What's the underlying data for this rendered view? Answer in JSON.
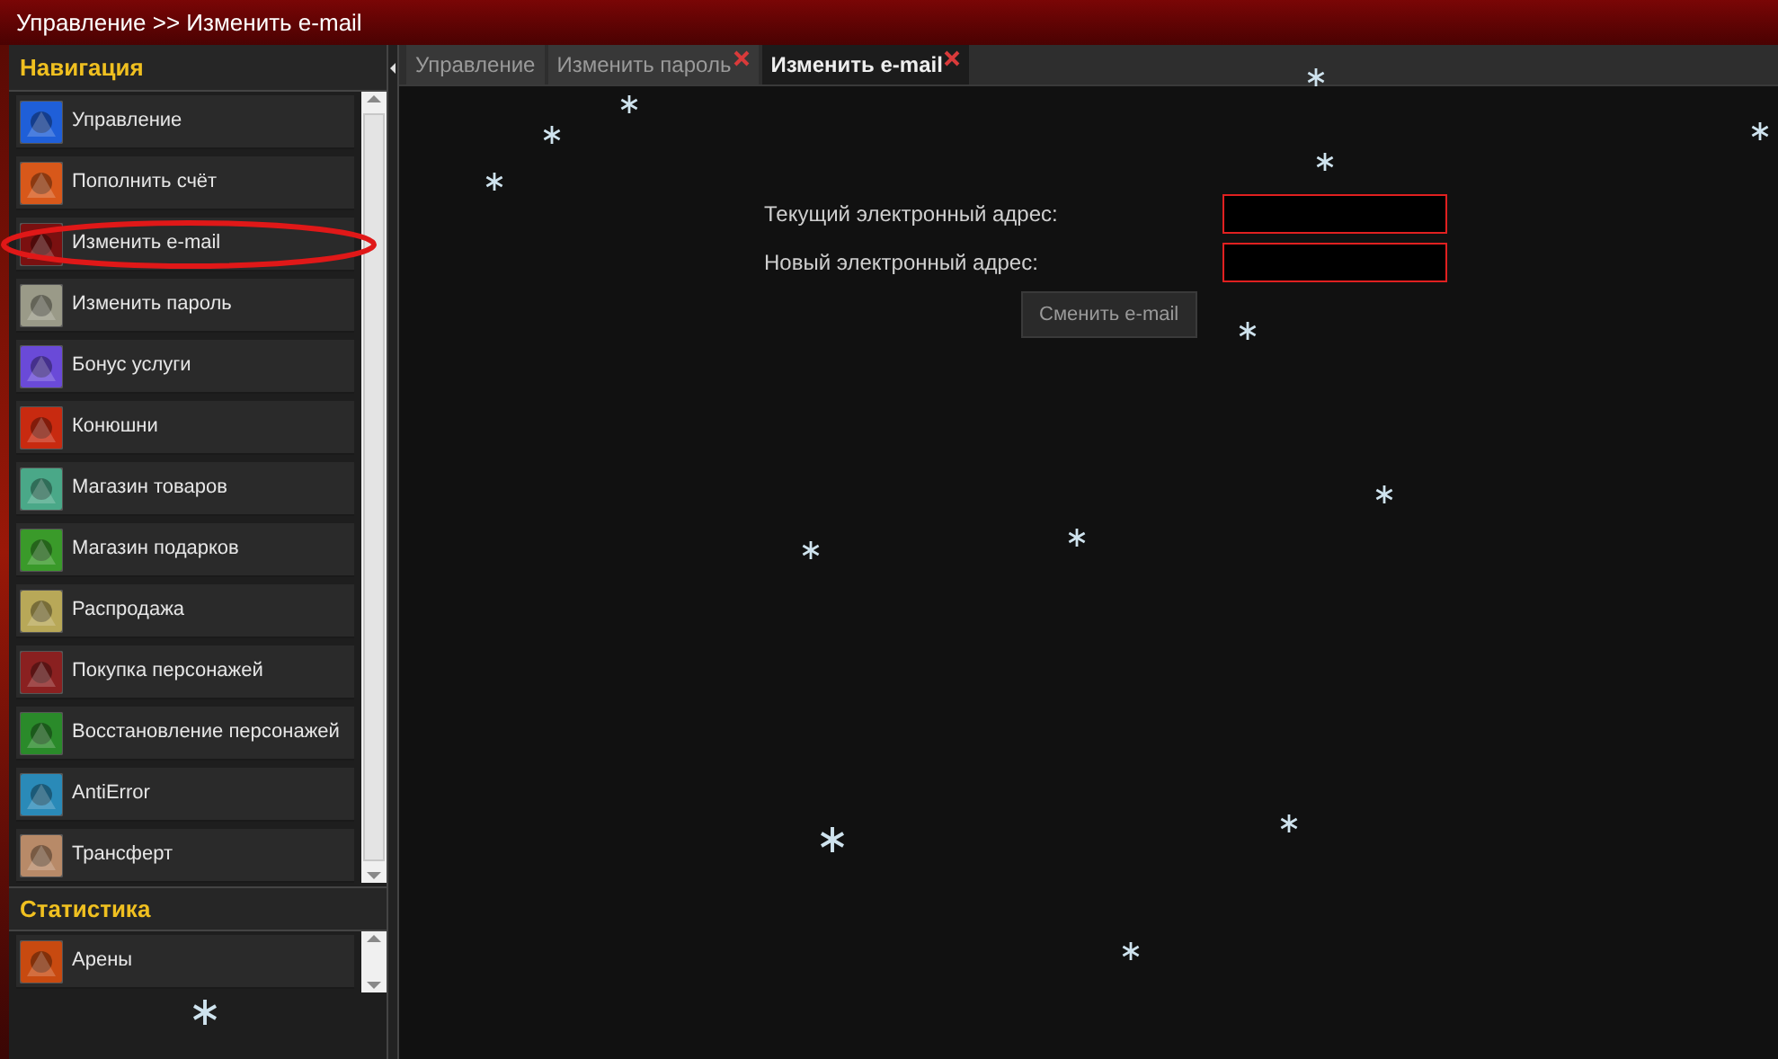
{
  "header": {
    "breadcrumb": "Управление >> Изменить e-mail"
  },
  "navigation": {
    "title": "Навигация",
    "items": [
      {
        "label": "Управление",
        "color": "#1f5fd8",
        "circled": false
      },
      {
        "label": "Пополнить счёт",
        "color": "#d8581a",
        "circled": false
      },
      {
        "label": "Изменить e-mail",
        "color": "#7a1010",
        "circled": true
      },
      {
        "label": "Изменить пароль",
        "color": "#9a9a88",
        "circled": false
      },
      {
        "label": "Бонус услуги",
        "color": "#6a4ad8",
        "circled": false
      },
      {
        "label": "Конюшни",
        "color": "#c82a10",
        "circled": false
      },
      {
        "label": "Магазин товаров",
        "color": "#4aa888",
        "circled": false
      },
      {
        "label": "Магазин подарков",
        "color": "#3a9a2a",
        "circled": false
      },
      {
        "label": "Распродажа",
        "color": "#b8a858",
        "circled": false
      },
      {
        "label": "Покупка персонажей",
        "color": "#8a2020",
        "circled": false
      },
      {
        "label": "Восстановление персонажей",
        "color": "#2a8a2a",
        "circled": false
      },
      {
        "label": "AntiError",
        "color": "#2a8ab8",
        "circled": false
      },
      {
        "label": "Трансферт",
        "color": "#b88a68",
        "circled": false
      }
    ]
  },
  "statistics": {
    "title": "Статистика",
    "items": [
      {
        "label": "Арены",
        "color": "#c84a10",
        "circled": false
      }
    ]
  },
  "tabs": [
    {
      "label": "Управление",
      "selected": false,
      "closable": false
    },
    {
      "label": "Изменить пароль",
      "selected": false,
      "closable": true
    },
    {
      "label": "Изменить e-mail",
      "selected": true,
      "closable": true
    }
  ],
  "form": {
    "fields": [
      {
        "label": "Текущий электронный адрес:",
        "invalid": true
      },
      {
        "label": "Новый электронный адрес:",
        "invalid": true
      }
    ],
    "submit": "Сменить e-mail"
  }
}
